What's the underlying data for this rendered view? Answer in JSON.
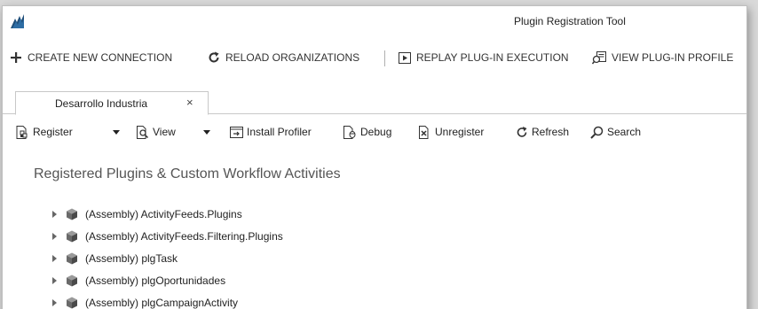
{
  "window": {
    "title": "Plugin Registration Tool"
  },
  "main_toolbar": {
    "create_connection": "CREATE NEW CONNECTION",
    "reload_orgs": "RELOAD ORGANIZATIONS",
    "replay": "REPLAY PLUG-IN EXECUTION",
    "view_profile": "VIEW PLUG-IN PROFILE"
  },
  "tab": {
    "label": "Desarrollo Industria",
    "close": "×"
  },
  "sub_toolbar": {
    "register": "Register",
    "view": "View",
    "install_profiler": "Install Profiler",
    "debug": "Debug",
    "unregister": "Unregister",
    "refresh": "Refresh",
    "search": "Search"
  },
  "heading": "Registered Plugins & Custom Workflow Activities",
  "tree": {
    "items": [
      {
        "label": "(Assembly) ActivityFeeds.Plugins"
      },
      {
        "label": "(Assembly) ActivityFeeds.Filtering.Plugins"
      },
      {
        "label": "(Assembly) plgTask"
      },
      {
        "label": "(Assembly) plgOportunidades"
      },
      {
        "label": "(Assembly) plgCampaignActivity"
      }
    ]
  },
  "colors": {
    "brand": "#1f4e79",
    "icon": "#333333",
    "text": "#222222"
  }
}
